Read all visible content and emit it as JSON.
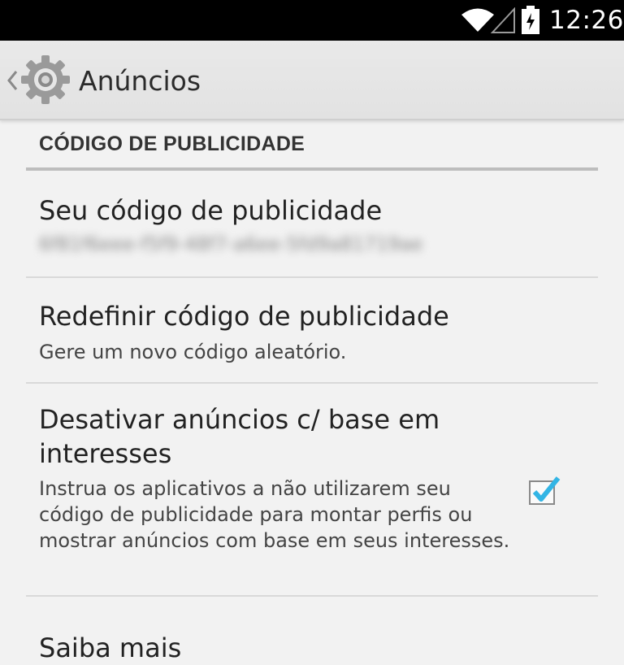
{
  "status_bar": {
    "time": "12:26"
  },
  "action_bar": {
    "title": "Anúncios"
  },
  "section": {
    "header": "CÓDIGO DE PUBLICIDADE"
  },
  "items": [
    {
      "title": "Seu código de publicidade",
      "summary": "6f81f6eee-f5f9-48f7-a6ee-5fd9a81719ae"
    },
    {
      "title": "Redefinir código de publicidade",
      "summary": "Gere um novo código aleatório."
    },
    {
      "title": "Desativar anúncios c/ base em interesses",
      "summary": "Instrua os aplicativos a não utilizarem seu código de publicidade para montar perfis ou mostrar anúncios com base em seus interesses.",
      "checked": true
    },
    {
      "title": "Saiba mais"
    }
  ],
  "colors": {
    "accent": "#33b5e5",
    "status_bar": "#000000",
    "action_bar": "#e6e6e6"
  },
  "icons": [
    "wifi-icon",
    "signal-icon",
    "battery-icon",
    "back-chevron-icon",
    "settings-gear-icon",
    "checkbox-checked-icon"
  ]
}
